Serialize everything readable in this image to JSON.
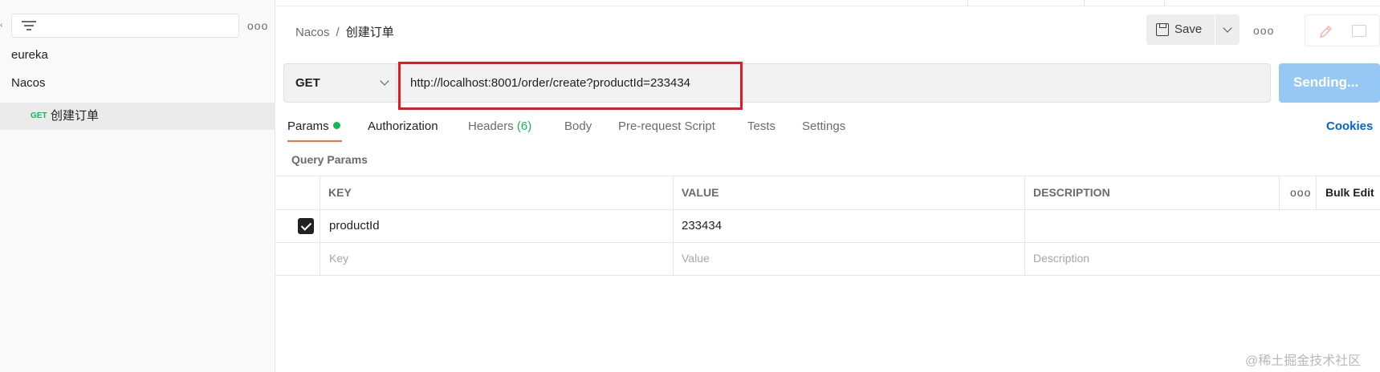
{
  "sidebar": {
    "filter_placeholder": "",
    "items": [
      {
        "label": "eureka"
      },
      {
        "label": "Nacos"
      },
      {
        "method": "GET",
        "label": "创建订单"
      }
    ]
  },
  "header": {
    "breadcrumb_parent": "Nacos",
    "breadcrumb_separator": "/",
    "breadcrumb_current": "创建订单",
    "save_label": "Save"
  },
  "request": {
    "method": "GET",
    "url": "http://localhost:8001/order/create?productId=233434",
    "send_label": "Sending..."
  },
  "tabs": {
    "params": "Params",
    "authorization": "Authorization",
    "headers": "Headers",
    "headers_count": "(6)",
    "body": "Body",
    "pre_request_script": "Pre-request Script",
    "tests": "Tests",
    "settings": "Settings",
    "cookies": "Cookies"
  },
  "query_params": {
    "title": "Query Params",
    "columns": {
      "key": "KEY",
      "value": "VALUE",
      "description": "DESCRIPTION"
    },
    "bulk_edit": "Bulk Edit",
    "rows": [
      {
        "checked": true,
        "key": "productId",
        "value": "233434",
        "description": ""
      }
    ],
    "placeholders": {
      "key": "Key",
      "value": "Value",
      "description": "Description"
    }
  },
  "watermark": "@稀土掘金技术社区",
  "colors": {
    "accent_orange": "#ff6c37",
    "success_green": "#0cbb52",
    "link_blue": "#0265d2",
    "send_button": "#96c8f5",
    "highlight_red": "#e01b24"
  }
}
